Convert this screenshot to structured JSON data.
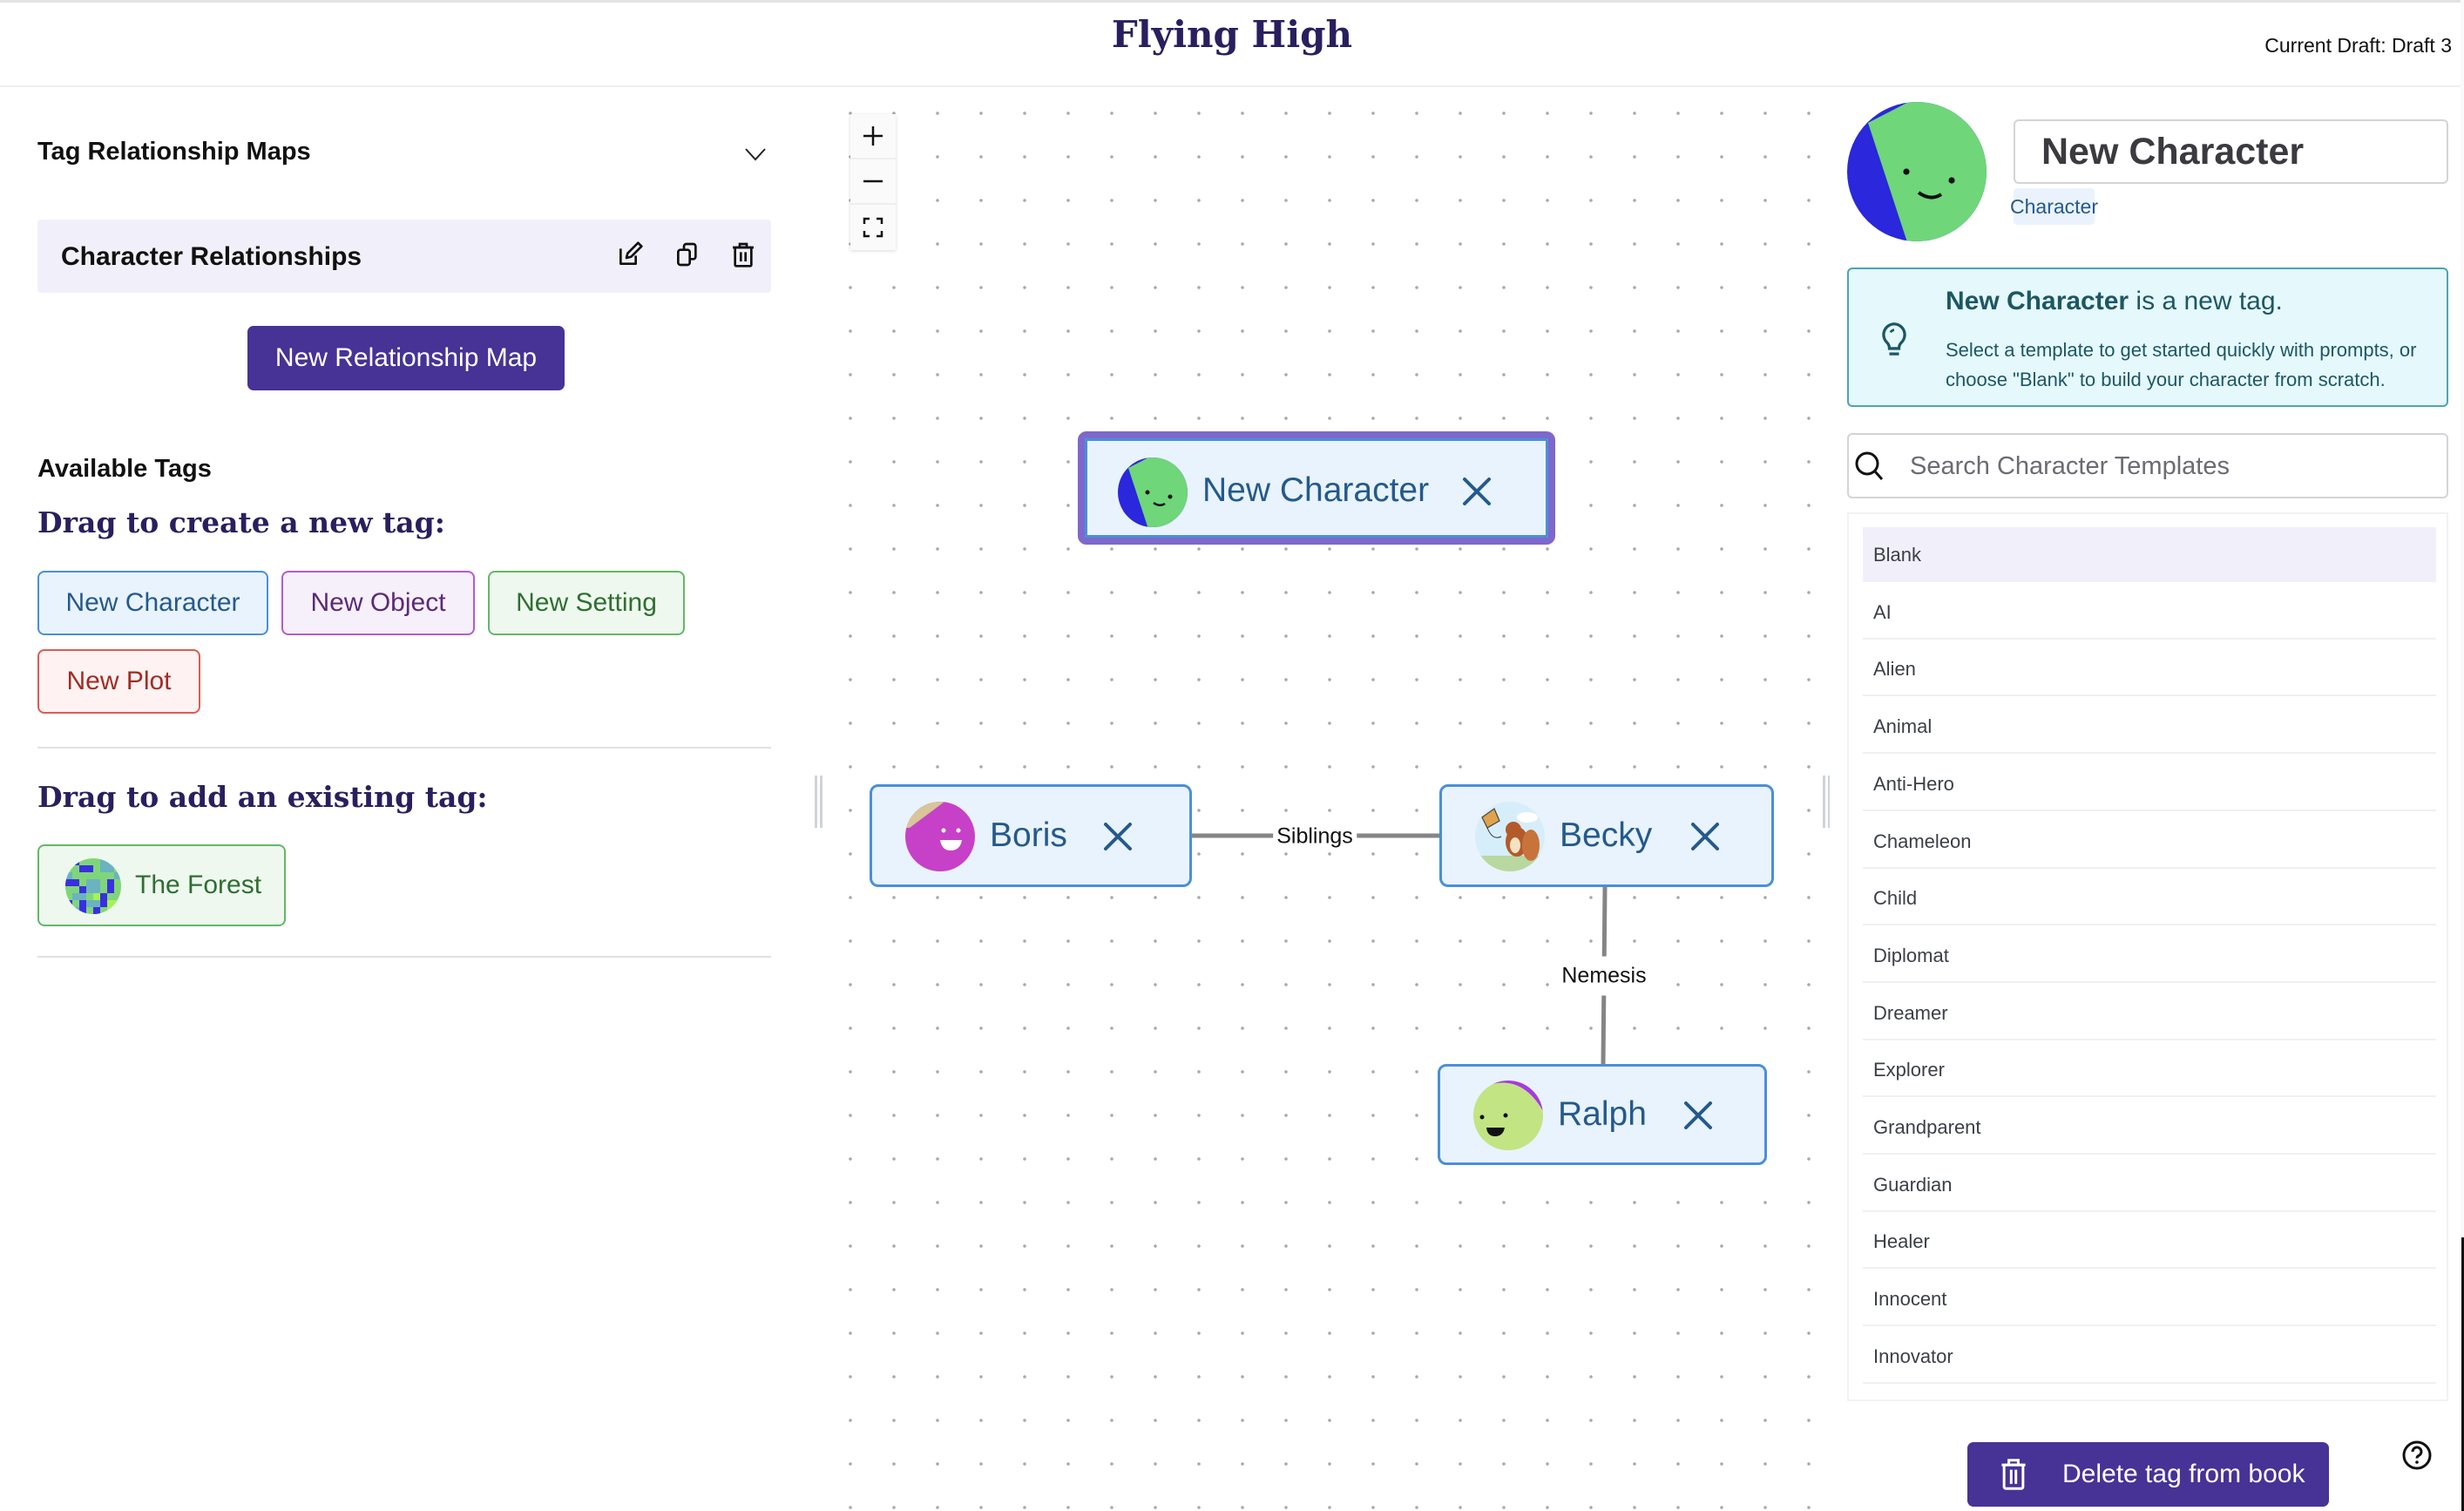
{
  "header": {
    "app_title": "Flying High",
    "current_draft": "Current Draft: Draft 3"
  },
  "left_panel": {
    "section_title": "Tag Relationship Maps",
    "collapse_icon": "chevron-down-icon",
    "maps": [
      {
        "label": "Character Relationships",
        "actions": [
          "edit-icon",
          "duplicate-icon",
          "trash-icon"
        ]
      }
    ],
    "new_map_button": "New Relationship Map",
    "available_tags_title": "Available Tags",
    "create_heading": "Drag to create a new tag:",
    "new_tag_buttons": [
      {
        "label": "New Character",
        "type": "character"
      },
      {
        "label": "New Object",
        "type": "object"
      },
      {
        "label": "New Setting",
        "type": "setting"
      },
      {
        "label": "New Plot",
        "type": "plot"
      }
    ],
    "existing_heading": "Drag to add an existing tag:",
    "existing_tags": [
      {
        "label": "The Forest",
        "type": "setting"
      }
    ]
  },
  "canvas": {
    "zoom_controls": [
      "zoom-in-icon",
      "zoom-out-icon",
      "fit-view-icon"
    ],
    "nodes": [
      {
        "id": "new-character",
        "label": "New Character",
        "selected": true
      },
      {
        "id": "boris",
        "label": "Boris",
        "selected": false
      },
      {
        "id": "becky",
        "label": "Becky",
        "selected": false
      },
      {
        "id": "ralph",
        "label": "Ralph",
        "selected": false
      }
    ],
    "edges": [
      {
        "from": "boris",
        "to": "becky",
        "label": "Siblings"
      },
      {
        "from": "becky",
        "to": "ralph",
        "label": "Nemesis"
      }
    ]
  },
  "right_panel": {
    "tag_name": "New Character",
    "tag_type": "Character",
    "info": {
      "name": "New Character",
      "suffix": " is a new tag.",
      "body": "Select a template to get started quickly with prompts, or choose \"Blank\" to build your character from scratch."
    },
    "search_placeholder": "Search Character Templates",
    "templates": [
      "Blank",
      "AI",
      "Alien",
      "Animal",
      "Anti-Hero",
      "Chameleon",
      "Child",
      "Diplomat",
      "Dreamer",
      "Explorer",
      "Grandparent",
      "Guardian",
      "Healer",
      "Innocent",
      "Innovator"
    ],
    "selected_template": "Blank",
    "delete_button": "Delete tag from book",
    "help_icon": "help-circle-icon"
  },
  "colors": {
    "primary": "#473296",
    "title": "#2a1f5e",
    "character": "#4a8fd8",
    "object": "#b45ad6",
    "setting": "#63b866",
    "plot": "#dc5c55",
    "selected_border": "#7d68cc",
    "info_border": "#4ba5b5"
  }
}
